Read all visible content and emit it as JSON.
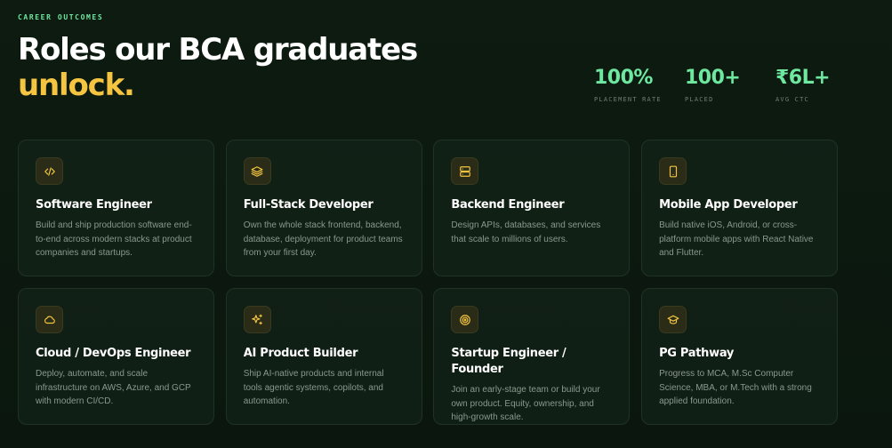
{
  "header": {
    "eyebrow": "CAREER OUTCOMES",
    "title_line1": "Roles our BCA graduates",
    "title_line2": "unlock."
  },
  "stats": [
    {
      "value": "100%",
      "label": "PLACEMENT RATE"
    },
    {
      "value": "100+",
      "label": "PLACED"
    },
    {
      "value": "₹6L+",
      "label": "AVG CTC"
    }
  ],
  "roles": [
    {
      "icon": "code-icon",
      "title": "Software Engineer",
      "description": "Build and ship production software end-to-end across modern stacks at product companies and startups."
    },
    {
      "icon": "layers-icon",
      "title": "Full-Stack Developer",
      "description": "Own the whole stack frontend, backend, database, deployment for product teams from your first day."
    },
    {
      "icon": "server-icon",
      "title": "Backend Engineer",
      "description": "Design APIs, databases, and services that scale to millions of users."
    },
    {
      "icon": "smartphone-icon",
      "title": "Mobile App Developer",
      "description": "Build native iOS, Android, or cross-platform mobile apps with React Native and Flutter."
    },
    {
      "icon": "cloud-icon",
      "title": "Cloud / DevOps Engineer",
      "description": "Deploy, automate, and scale infrastructure on AWS, Azure, and GCP with modern CI/CD."
    },
    {
      "icon": "sparkles-icon",
      "title": "AI Product Builder",
      "description": "Ship AI-native products and internal tools agentic systems, copilots, and automation."
    },
    {
      "icon": "target-icon",
      "title": "Startup Engineer / Founder",
      "description": "Join an early-stage team or build your own product. Equity, ownership, and high-growth scale."
    },
    {
      "icon": "graduation-cap-icon",
      "title": "PG Pathway",
      "description": "Progress to MCA, M.Sc Computer Science, MBA, or M.Tech with a strong applied foundation."
    }
  ],
  "colors": {
    "accent_green": "#6ee7a0",
    "accent_yellow": "#f5c542",
    "background": "#0c1a0f"
  }
}
